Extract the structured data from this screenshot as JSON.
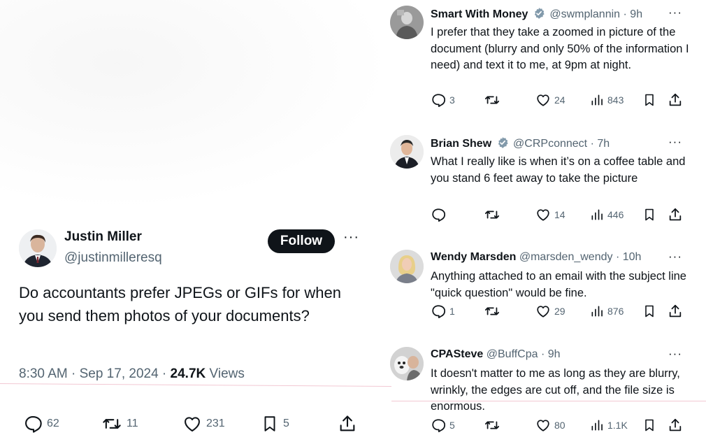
{
  "main_tweet": {
    "author_name": "Justin Miller",
    "author_handle": "@justinmilleresq",
    "follow_label": "Follow",
    "more_label": "···",
    "text": "Do accountants prefer JPEGs or GIFs for when you send them photos of your documents?",
    "timestamp": "8:30 AM · Sep 17, 2024 · ",
    "views_count": "24.7K",
    "views_label": "Views",
    "replies": "62",
    "retweets": "11",
    "likes": "231",
    "bookmarks": "5"
  },
  "replies": [
    {
      "name": "Smart With Money",
      "verified": true,
      "handle": "@swmplannin",
      "time": "· 9h",
      "text": "I prefer that they take a zoomed in picture of the document (blurry and only 50% of the information I need) and text it to me, at 9pm at night.",
      "replies": "3",
      "retweets": "",
      "likes": "24",
      "views": "843"
    },
    {
      "name": "Brian Shew",
      "verified": true,
      "handle": "@CRPconnect",
      "time": "· 7h",
      "text": "What I really like is when it’s on a coffee table and you stand 6 feet away to take the picture",
      "replies": "",
      "retweets": "",
      "likes": "14",
      "views": "446"
    },
    {
      "name": "Wendy Marsden",
      "verified": false,
      "handle": "@marsden_wendy",
      "time": "· 10h",
      "text": "Anything attached to an email with the subject line \"quick question\" would be fine.",
      "replies": "1",
      "retweets": "",
      "likes": "29",
      "views": "876"
    },
    {
      "name": "CPASteve",
      "verified": false,
      "handle": "@BuffCpa",
      "time": "· 9h",
      "text": "It doesn't matter to me as long as they are blurry, wrinkly, the edges are cut off, and the file size is enormous.",
      "replies": "5",
      "retweets": "",
      "likes": "80",
      "views": "1.1K"
    }
  ],
  "more_label": "···",
  "icons": {
    "reply": "speech-bubble-icon",
    "retweet": "retweet-arrows-icon",
    "like": "heart-icon",
    "views": "bar-chart-icon",
    "bookmark": "bookmark-icon",
    "share": "share-upload-icon",
    "verified": "verified-badge-icon"
  },
  "colors": {
    "text": "#0f1419",
    "secondary": "#536471",
    "follow_bg": "#0f1419",
    "verified_badge": "#829aab"
  }
}
